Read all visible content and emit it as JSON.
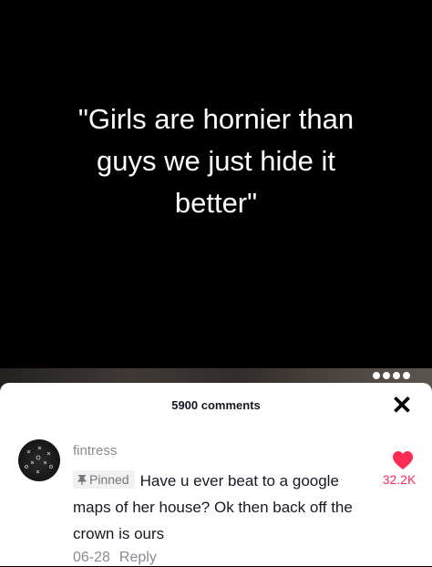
{
  "video": {
    "caption": "\"Girls are hornier than\nguys we just hide it\nbetter\""
  },
  "comments_sheet": {
    "count_label": "5900 comments",
    "close_icon": "close-icon"
  },
  "comment": {
    "username": "fintress",
    "pinned_label": "Pinned",
    "text": "Have u ever beat to a google maps of her house? Ok then back off the crown is ours",
    "date": "06-28",
    "reply_label": "Reply",
    "likes": "32.2K"
  },
  "colors": {
    "like": "#fe2c55",
    "secondary_text": "#8a8b91",
    "primary_text": "#161823"
  }
}
